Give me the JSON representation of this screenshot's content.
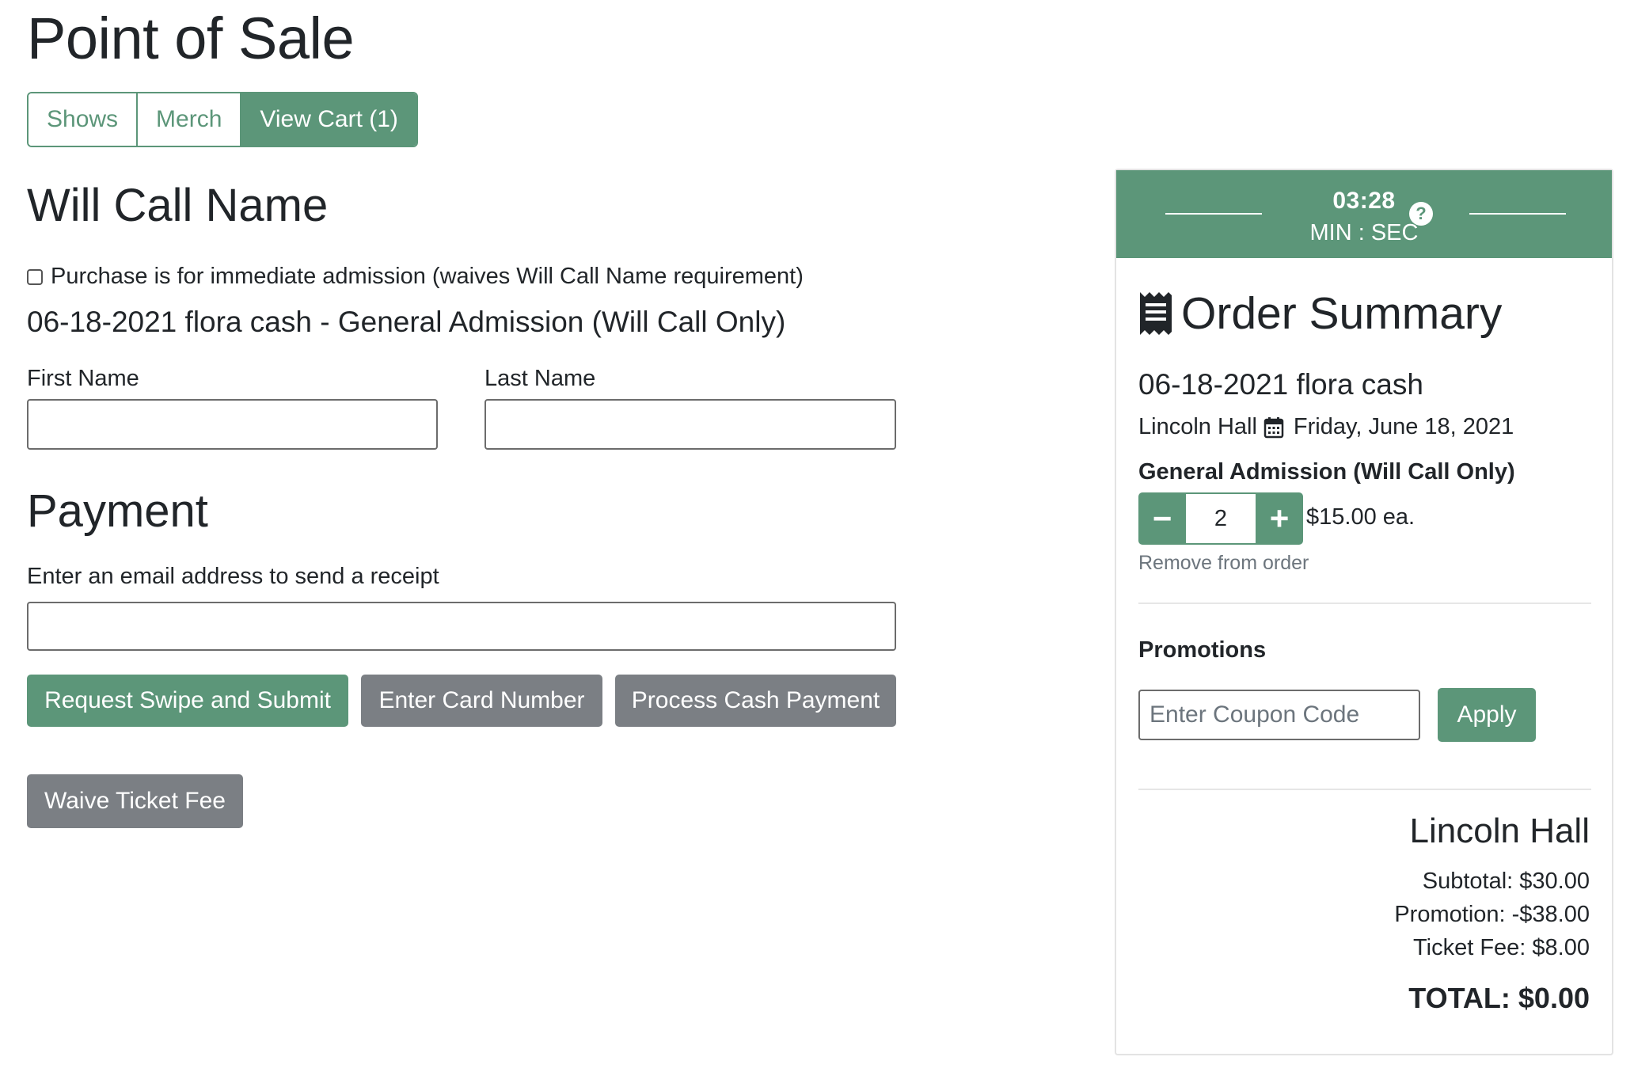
{
  "page": {
    "title": "Point of Sale"
  },
  "nav": {
    "tabs": [
      "Shows",
      "Merch",
      "View Cart (1)"
    ],
    "active_index": 2
  },
  "will_call": {
    "heading": "Will Call Name",
    "checkbox_label": "Purchase is for immediate admission (waives Will Call Name requirement)",
    "checkbox_checked": false,
    "ticket_line": "06-18-2021 flora cash - General Admission (Will Call Only)",
    "first_name_label": "First Name",
    "first_name_value": "",
    "last_name_label": "Last Name",
    "last_name_value": ""
  },
  "payment": {
    "heading": "Payment",
    "email_label": "Enter an email address to send a receipt",
    "email_value": "",
    "buttons": {
      "swipe": "Request Swipe and Submit",
      "card": "Enter Card Number",
      "cash": "Process Cash Payment",
      "waive": "Waive Ticket Fee"
    }
  },
  "timer": {
    "time": "03:28",
    "unit": "MIN : SEC",
    "help_icon": "question-circle-icon"
  },
  "summary": {
    "title": "Order Summary",
    "title_icon": "receipt-icon",
    "show": "06-18-2021 flora cash",
    "venue": "Lincoln Hall",
    "date_icon": "calendar-icon",
    "date": "Friday, June 18, 2021",
    "ticket_type": "General Admission (Will Call Only)",
    "quantity": "2",
    "decrement": "−",
    "increment": "+",
    "price_each": "$15.00 ea.",
    "remove": "Remove from order",
    "promotions_title": "Promotions",
    "coupon_placeholder": "Enter Coupon Code",
    "apply": "Apply",
    "venue_total_heading": "Lincoln Hall",
    "subtotal": "Subtotal: $30.00",
    "promotion": "Promotion: -$38.00",
    "ticket_fee": "Ticket Fee: $8.00",
    "total": "TOTAL: $0.00"
  },
  "colors": {
    "accent": "#5c9679",
    "secondary": "#7b7f84"
  }
}
